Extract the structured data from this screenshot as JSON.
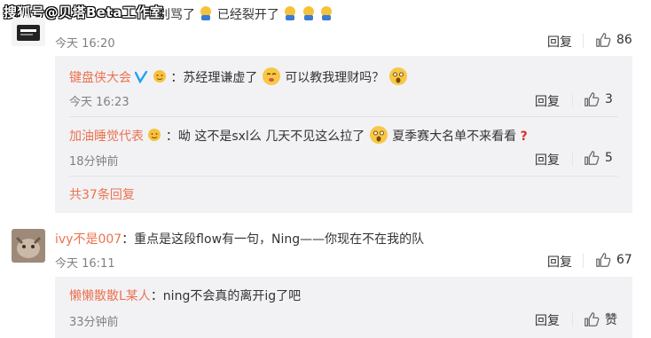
{
  "watermark": "搜狐号@贝塔Beta工作室",
  "comment1": {
    "text_a": "别骂了",
    "text_b": "已经裂开了",
    "time": "今天 16:20",
    "reply_label": "回复",
    "like_count": "86",
    "replies": [
      {
        "user": "键盘侠大会",
        "content_a": "：苏经理谦虚了",
        "content_b": "可以教我理财吗？",
        "time": "今天 16:23",
        "reply_label": "回复",
        "like_count": "3"
      },
      {
        "user": "加油睡觉代表",
        "content_a": "：呦 这不是sxl么 几天不见这么拉了",
        "content_b": "夏季赛大名单不来看看",
        "time": "18分钟前",
        "reply_label": "回复",
        "like_count": "5"
      }
    ],
    "more_replies": "共37条回复"
  },
  "comment2": {
    "user": "ivy不是007",
    "content": "：重点是这段flow有一句，Ning——你现在不在我的队",
    "time": "今天 16:11",
    "reply_label": "回复",
    "like_count": "67",
    "replies": [
      {
        "user": "懒懒散散L某人",
        "content": "：ning不会真的离开ig了吧",
        "time": "33分钟前",
        "reply_label": "回复",
        "like_label": "赞"
      }
    ]
  },
  "colors": {
    "username": "#eb7350",
    "subbox_bg": "#f2f2f5",
    "text": "#333333",
    "meta": "#808080"
  },
  "icons": [
    "thumbs-up-icon",
    "verified-v-icon",
    "face-emoji-icon",
    "facepalm-emoji-icon",
    "question-mark-icon",
    "avatar-image"
  ]
}
